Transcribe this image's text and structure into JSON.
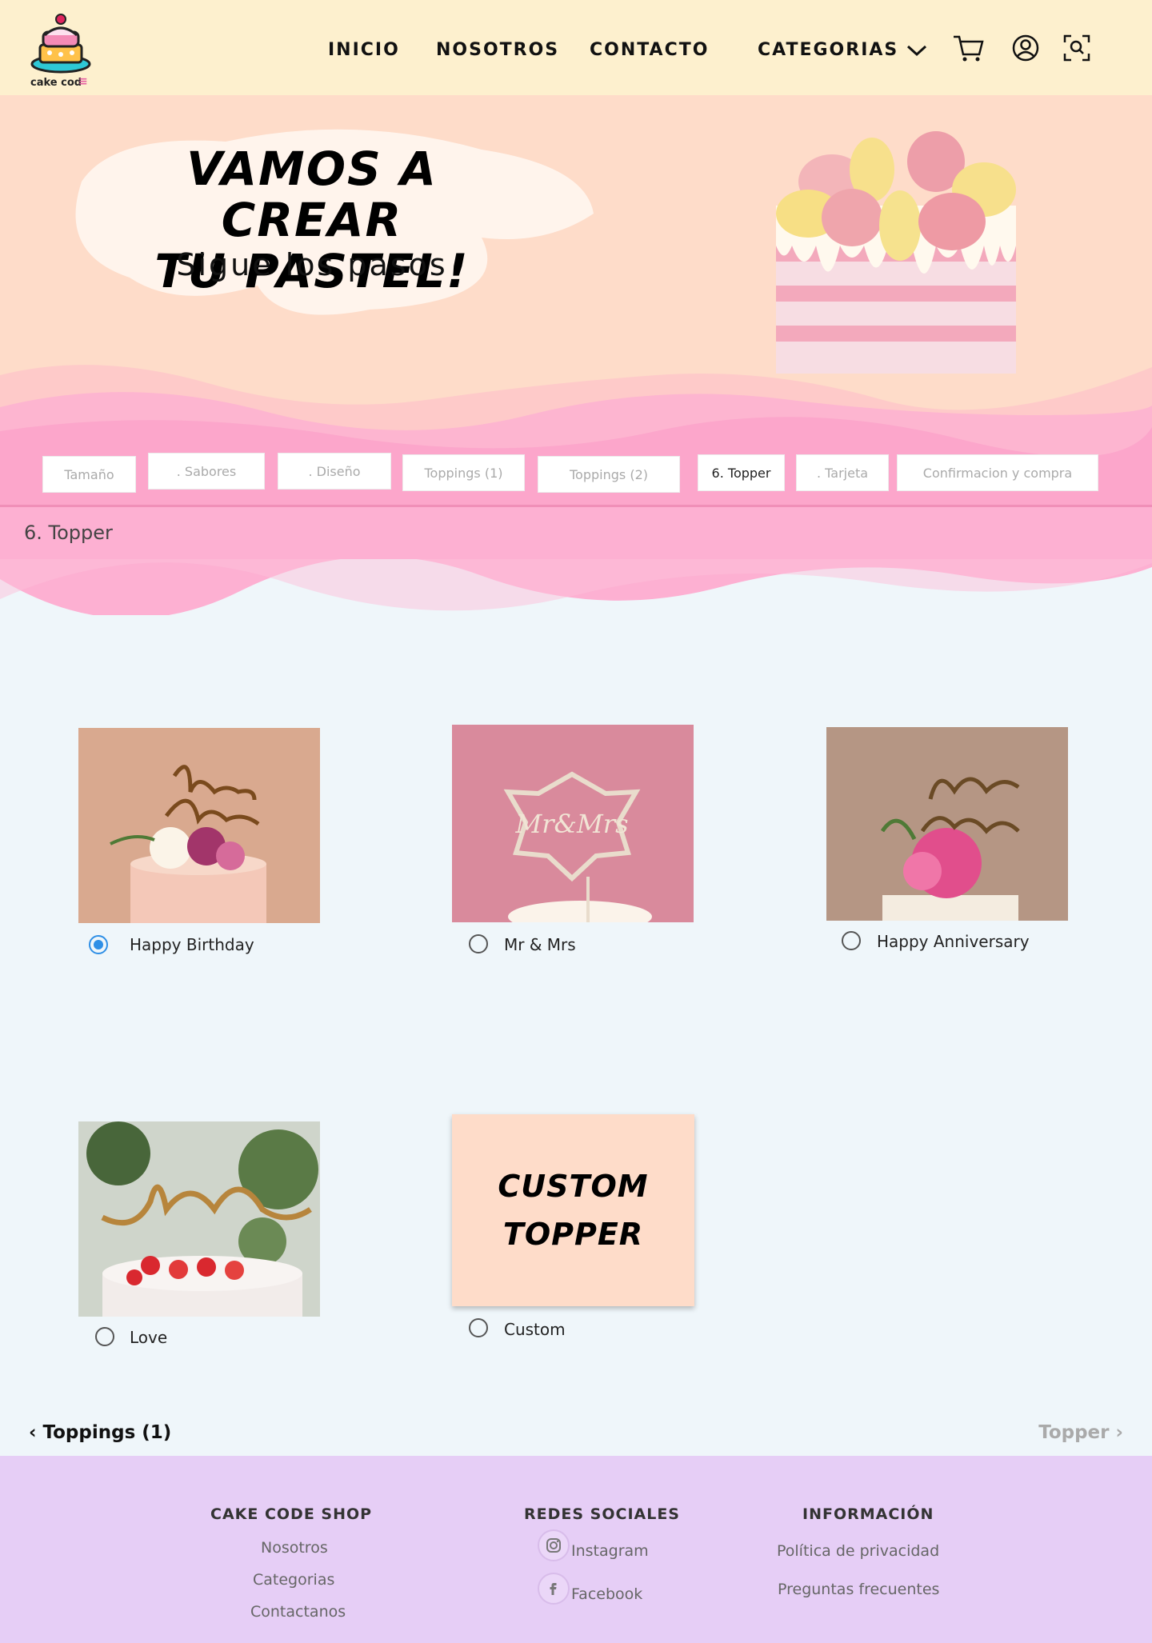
{
  "nav": {
    "brand": "cake cod",
    "links": [
      "INICIO",
      "NOSOTROS",
      "CONTACTO",
      "CATEGORIAS"
    ]
  },
  "hero": {
    "title_line1": "VAMOS A CREAR",
    "title_line2": "TU PASTEL!",
    "subtitle": "Sigue los pasos"
  },
  "steps": [
    {
      "label": "Tamaño"
    },
    {
      "label": ". Sabores"
    },
    {
      "label": ". Diseño"
    },
    {
      "label": "Toppings (1)"
    },
    {
      "label": "Toppings (2)"
    },
    {
      "label": "6. Topper"
    },
    {
      "label": ". Tarjeta"
    },
    {
      "label": "Confirmacion y compra"
    }
  ],
  "active_step": "6. Topper",
  "section_title": "6. Topper",
  "options": [
    {
      "label": "Happy Birthday",
      "selected": true
    },
    {
      "label": "Mr & Mrs",
      "selected": false
    },
    {
      "label": "Happy Anniversary",
      "selected": false
    },
    {
      "label": "Love",
      "selected": false
    },
    {
      "label": "Custom",
      "selected": false
    }
  ],
  "custom_card": {
    "line1": "CUSTOM",
    "line2": "TOPPER"
  },
  "pager": {
    "prev": "Toppings (1)",
    "next": "Topper"
  },
  "footer": {
    "col1": {
      "title": "CAKE CODE SHOP",
      "links": [
        "Nosotros",
        "Categorias",
        "Contactanos"
      ]
    },
    "col2": {
      "title": "REDES SOCIALES",
      "links": [
        "Instagram",
        "Facebook"
      ]
    },
    "col3": {
      "title": "INFORMACIÓN",
      "links": [
        "Política de privacidad",
        "Preguntas frecuentes"
      ]
    }
  },
  "colors": {
    "nav_bg": "#fdf0ce",
    "hero_bg": "#fedcc9",
    "pink": "#fdb0d2",
    "page_bg": "#eff6fa",
    "footer_bg": "#e6cef6",
    "radio_selected": "#2f8fe6"
  }
}
